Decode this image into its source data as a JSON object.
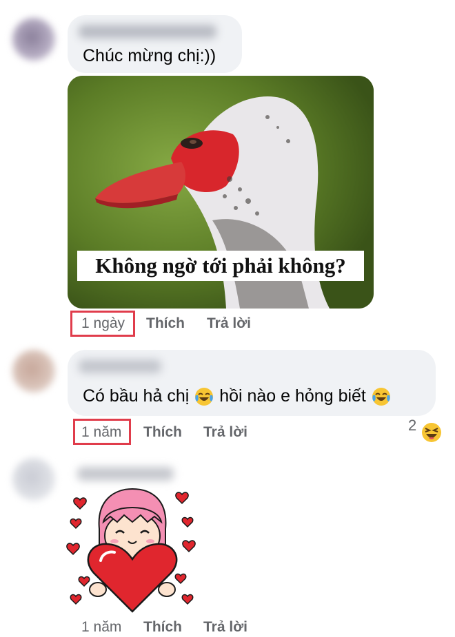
{
  "comments": [
    {
      "text": "Chúc mừng chị:))",
      "image_caption": "Không ngờ tới phải không?",
      "time": "1 ngày",
      "like_label": "Thích",
      "reply_label": "Trả lời"
    },
    {
      "text_part1": "Có bầu hả chị",
      "text_part2": "hồi nào e hỏng biết",
      "inline_emoji": "face-with-tears-of-joy-icon",
      "time": "1 năm",
      "like_label": "Thích",
      "reply_label": "Trả lời",
      "reaction_count": "2",
      "reaction_icon": "haha-reaction-icon"
    },
    {
      "sticker": "girl-holding-heart-sticker",
      "time": "1 năm",
      "like_label": "Thích",
      "reply_label": "Trả lời"
    }
  ],
  "colors": {
    "bubble": "#f0f2f5",
    "meta_text": "#65676b",
    "highlight_box": "#e03c4b"
  }
}
